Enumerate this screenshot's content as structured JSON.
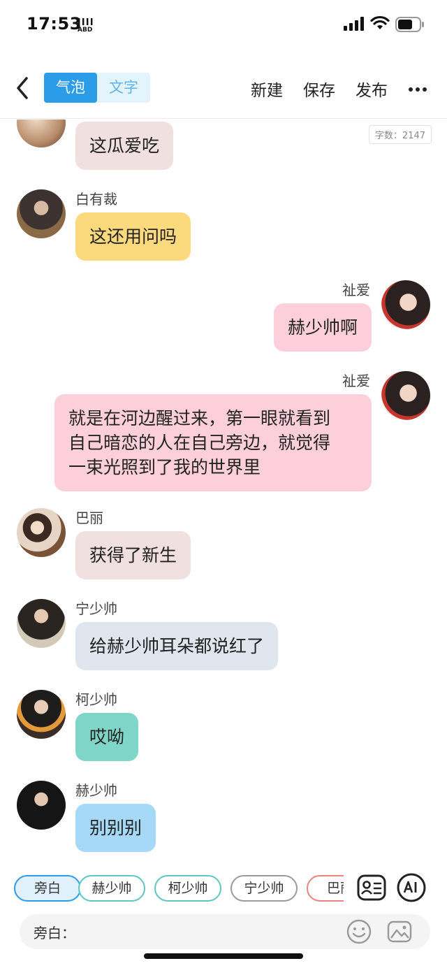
{
  "status": {
    "time": "17:53",
    "carrier_badge": "ABD"
  },
  "nav": {
    "tabs": [
      "气泡",
      "文字"
    ],
    "actions": [
      "新建",
      "保存",
      "发布"
    ]
  },
  "word_count": "字数：2147",
  "messages": [
    {
      "side": "left",
      "name": "",
      "text": "这瓜爱吃",
      "color": "#f0e0e0"
    },
    {
      "side": "left",
      "name": "白有裁",
      "text": "这还用问吗",
      "color": "#fbd97d"
    },
    {
      "side": "right",
      "name": "祉爱",
      "text": "赫少帅啊",
      "color": "#fccfdb"
    },
    {
      "side": "right",
      "name": "祉爱",
      "lines": [
        "就是在河边醒过来，第一眼就看到",
        "自己暗恋的人在自己旁边，就觉得",
        "一束光照到了我的世界里"
      ],
      "color": "#fccfdb"
    },
    {
      "side": "left",
      "name": "巴丽",
      "text": "获得了新生",
      "color": "#f0e0e0"
    },
    {
      "side": "left",
      "name": "宁少帅",
      "text": "给赫少帅耳朵都说红了",
      "color": "#dfe6ee"
    },
    {
      "side": "left",
      "name": "柯少帅",
      "text": "哎呦",
      "color": "#7fd6c8"
    },
    {
      "side": "left",
      "name": "赫少帅",
      "text": "别别别",
      "color": "#a6d9f7"
    }
  ],
  "chips": [
    "旁白",
    "赫少帅",
    "柯少帅",
    "宁少帅",
    "巴丽"
  ],
  "input": {
    "label": "旁白："
  },
  "icons": {
    "back": "chevron-left-icon",
    "more": "more-dots-icon",
    "contact": "contact-card-icon",
    "ai": "ai-icon",
    "emoji": "emoji-icon",
    "image": "image-icon"
  }
}
